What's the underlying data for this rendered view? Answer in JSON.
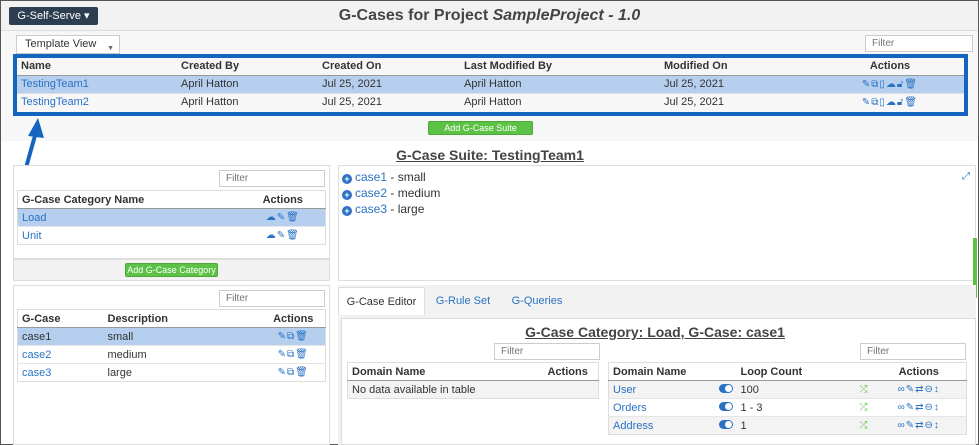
{
  "header": {
    "menu_label": "G-Self-Serve ▾",
    "title_prefix": "G-Cases for Project ",
    "title_project": "SampleProject - 1.0"
  },
  "suites_table": {
    "view_select": "Template View",
    "filter_placeholder": "Filter",
    "columns": [
      "Name",
      "Created By",
      "Created On",
      "Last Modified By",
      "Modified On",
      "Actions"
    ],
    "rows": [
      {
        "name": "TestingTeam1",
        "created_by": "April Hatton",
        "created_on": "Jul 25, 2021",
        "modified_by": "April Hatton",
        "modified_on": "Jul 25, 2021",
        "selected": true
      },
      {
        "name": "TestingTeam2",
        "created_by": "April Hatton",
        "created_on": "Jul 25, 2021",
        "modified_by": "April Hatton",
        "modified_on": "Jul 25, 2021",
        "selected": false
      }
    ],
    "add_button": "Add G-Case Suite"
  },
  "suite_title": "G-Case Suite: TestingTeam1",
  "category_table": {
    "filter_placeholder": "Filter",
    "columns": [
      "G-Case Category Name",
      "Actions"
    ],
    "rows": [
      {
        "name": "Load",
        "selected": true
      },
      {
        "name": "Unit",
        "selected": false
      }
    ],
    "add_button": "Add G-Case Category"
  },
  "cases_list": [
    {
      "name": "case1",
      "desc": " - small"
    },
    {
      "name": "case2",
      "desc": " - medium"
    },
    {
      "name": "case3",
      "desc": " - large"
    }
  ],
  "case_table": {
    "filter_placeholder": "Filter",
    "columns": [
      "G-Case",
      "Description",
      "Actions"
    ],
    "rows": [
      {
        "name": "case1",
        "desc": "small",
        "selected": true
      },
      {
        "name": "case2",
        "desc": "medium",
        "selected": false
      },
      {
        "name": "case3",
        "desc": "large",
        "selected": false
      }
    ]
  },
  "tabs": [
    "G-Case Editor",
    "G-Rule Set",
    "G-Queries"
  ],
  "editor": {
    "title": "G-Case Category: Load, G-Case: case1",
    "left_filter": "Filter",
    "right_filter": "Filter",
    "left_columns": [
      "Domain Name",
      "Actions"
    ],
    "left_empty": "No data available in table",
    "right_columns": [
      "Domain Name",
      "Loop Count",
      "Actions"
    ],
    "right_rows": [
      {
        "name": "User",
        "loop": "100"
      },
      {
        "name": "Orders",
        "loop": "1 - 3"
      },
      {
        "name": "Address",
        "loop": "1"
      }
    ]
  },
  "colors": {
    "accent": "#2a72c4",
    "highlight": "#1565c0",
    "button": "#5cc245",
    "selected_row": "#b6cfee"
  }
}
